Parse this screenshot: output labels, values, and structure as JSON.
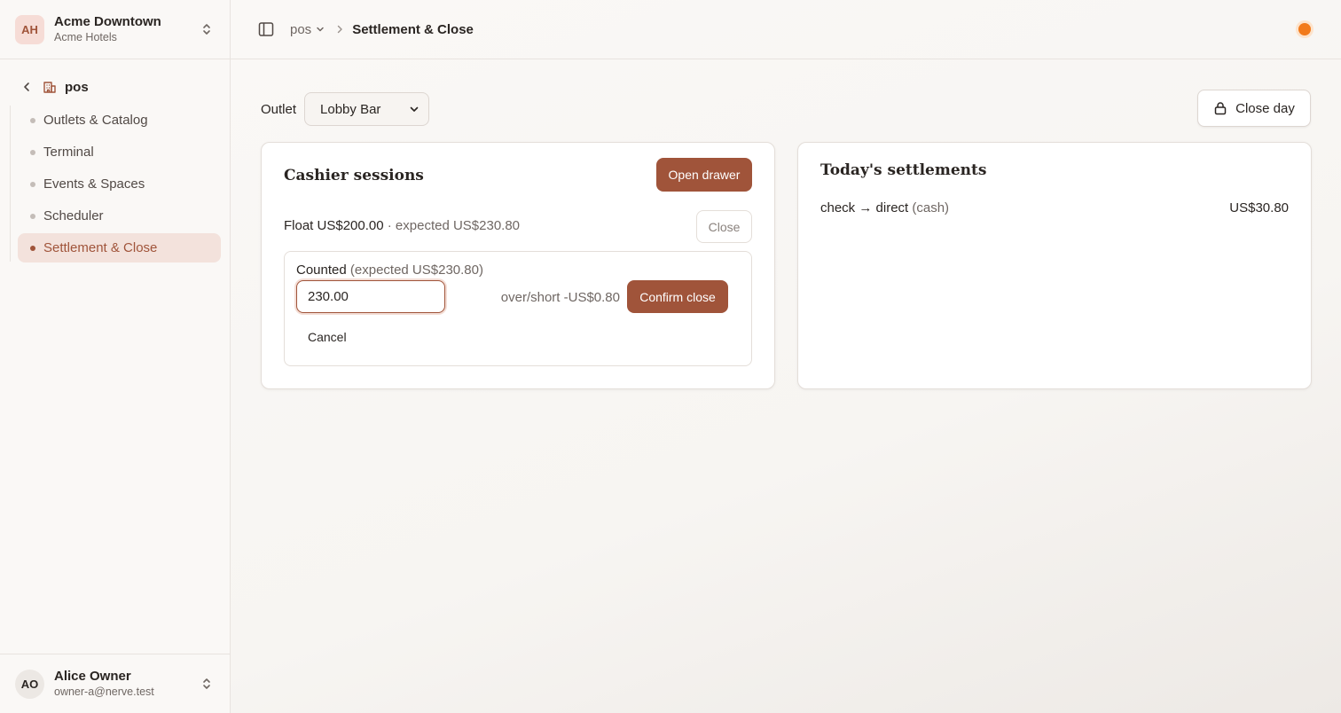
{
  "org": {
    "initials": "AH",
    "name": "Acme Downtown",
    "subtitle": "Acme Hotels"
  },
  "nav": {
    "back_label": "pos",
    "items": [
      {
        "label": "Outlets & Catalog",
        "active": false
      },
      {
        "label": "Terminal",
        "active": false
      },
      {
        "label": "Events & Spaces",
        "active": false
      },
      {
        "label": "Scheduler",
        "active": false
      },
      {
        "label": "Settlement & Close",
        "active": true
      }
    ]
  },
  "user": {
    "initials": "AO",
    "name": "Alice Owner",
    "email": "owner-a@nerve.test"
  },
  "breadcrumb": {
    "module": "pos",
    "current": "Settlement & Close"
  },
  "toolbar": {
    "outlet_label": "Outlet",
    "outlet_value": "Lobby Bar",
    "close_day_label": "Close day"
  },
  "cashier": {
    "title": "Cashier sessions",
    "open_drawer_label": "Open drawer",
    "float_text": "Float US$200.00",
    "expected_text": "· expected US$230.80",
    "close_label": "Close",
    "counted_label": "Counted",
    "counted_expected": "(expected US$230.80)",
    "counted_value": "230.00",
    "over_short": "over/short -US$0.80",
    "confirm_label": "Confirm close",
    "cancel_label": "Cancel"
  },
  "settlements": {
    "title": "Today's settlements",
    "rows": [
      {
        "flow": "check → direct",
        "method": "(cash)",
        "amount": "US$30.80"
      }
    ]
  },
  "colors": {
    "accent": "#a0543a",
    "status": "#f27a1b",
    "active_bg": "#f3e2dc"
  }
}
